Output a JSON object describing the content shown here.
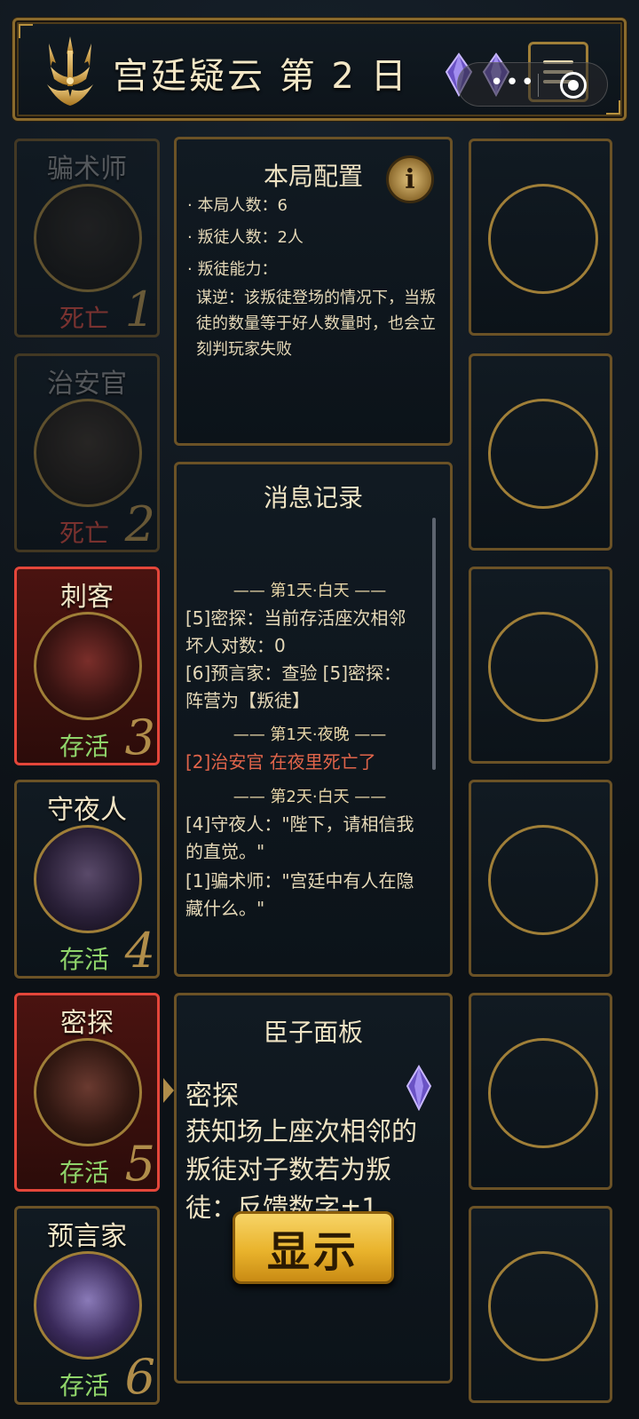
{
  "header": {
    "title": "宫廷疑云 第 2 日",
    "menu_icon": "hamburger-menu-icon",
    "capsule_dots": "•••"
  },
  "players": [
    {
      "seat": "1",
      "name": "骗术师",
      "status": "死亡",
      "alive": false,
      "marked": false
    },
    {
      "seat": "2",
      "name": "治安官",
      "status": "死亡",
      "alive": false,
      "marked": false
    },
    {
      "seat": "3",
      "name": "刺客",
      "status": "存活",
      "alive": true,
      "marked": true
    },
    {
      "seat": "4",
      "name": "守夜人",
      "status": "存活",
      "alive": true,
      "marked": false
    },
    {
      "seat": "5",
      "name": "密探",
      "status": "存活",
      "alive": true,
      "marked": true
    },
    {
      "seat": "6",
      "name": "预言家",
      "status": "存活",
      "alive": true,
      "marked": false
    }
  ],
  "config": {
    "title": "本局配置",
    "info_label": "i",
    "player_count": "· 本局人数：6",
    "traitor_count": "· 叛徒人数：2人",
    "traitor_ability": "· 叛徒能力：",
    "description": "谋逆：该叛徒登场的情况下，当叛徒的数量等于好人数量时，也会立刻判玩家失败"
  },
  "log": {
    "title": "消息记录",
    "sep1": "—— 第1天·白天 ——",
    "entry1": "[5]密探：当前存活座次相邻坏人对数：0",
    "entry2": "[6]预言家：查验 [5]密探：阵营为【叛徒】",
    "sep2": "—— 第1天·夜晚 ——",
    "entry3": "[2]治安官 在夜里死亡了",
    "sep3": "—— 第2天·白天 ——",
    "entry4": "[4]守夜人：\"陛下，请相信我的直觉。\"",
    "entry5": "[1]骗术师：\"宫廷中有人在隐藏什么。\""
  },
  "minister": {
    "title": "臣子面板",
    "role": "密探",
    "description": "获知场上座次相邻的叛徒对子数若为叛徒：反馈数字±1",
    "show_button": "显示"
  },
  "colors": {
    "gold": "#b08d4a",
    "alive": "#8fd46a",
    "dead": "#d0473c",
    "marked_border": "#e4463a",
    "gem": "#8a6fd8"
  }
}
